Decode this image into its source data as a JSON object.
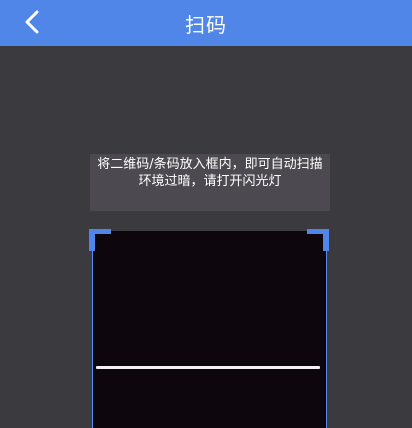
{
  "header": {
    "title": "扫码",
    "back_icon": "chevron-left-icon"
  },
  "scanner": {
    "tip_line1": "将二维码/条码放入框内，即可自动扫描",
    "tip_line2": "环境过暗，请打开闪光灯"
  },
  "colors": {
    "header_bg": "#4f86e7",
    "page_bg": "#3b3a3e",
    "scan_bg": "#0d060d",
    "corner": "#4f86e7"
  }
}
